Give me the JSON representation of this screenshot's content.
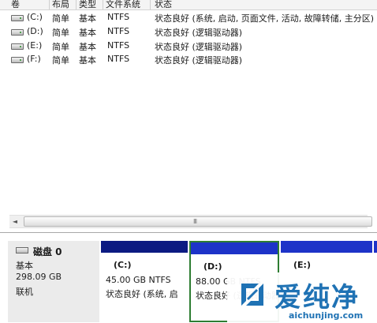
{
  "columns": [
    "卷",
    "布局",
    "类型",
    "文件系统",
    "状态"
  ],
  "volumes": [
    {
      "name": "(C:)",
      "layout": "简单",
      "type": "基本",
      "fs": "NTFS",
      "status": "状态良好 (系统, 启动, 页面文件, 活动, 故障转储, 主分区)"
    },
    {
      "name": "(D:)",
      "layout": "简单",
      "type": "基本",
      "fs": "NTFS",
      "status": "状态良好 (逻辑驱动器)"
    },
    {
      "name": "(E:)",
      "layout": "简单",
      "type": "基本",
      "fs": "NTFS",
      "status": "状态良好 (逻辑驱动器)"
    },
    {
      "name": "(F:)",
      "layout": "简单",
      "type": "基本",
      "fs": "NTFS",
      "status": "状态良好 (逻辑驱动器)"
    }
  ],
  "scrollbar": {
    "left_arrow": "◄",
    "grip": "III"
  },
  "disk": {
    "name": "磁盘 0",
    "type": "基本",
    "size": "298.09 GB",
    "state": "联机"
  },
  "partitions": [
    {
      "name": "(C:)",
      "size": "45.00 GB NTFS",
      "status": "状态良好 (系统, 启"
    },
    {
      "name": "(D:)",
      "size": "88.00 GB NTFS",
      "status": "状态良好 (逻辑驱动器)"
    },
    {
      "name": "(E:)",
      "size": "",
      "status": ""
    }
  ],
  "watermark": {
    "brand": "爱纯净",
    "url": "aichunjing.com"
  },
  "colors": {
    "primary_partition": "#0c1a82",
    "logical_partition": "#1d33c8",
    "selection": "#2e7d32",
    "watermark": "#1f72b4"
  }
}
